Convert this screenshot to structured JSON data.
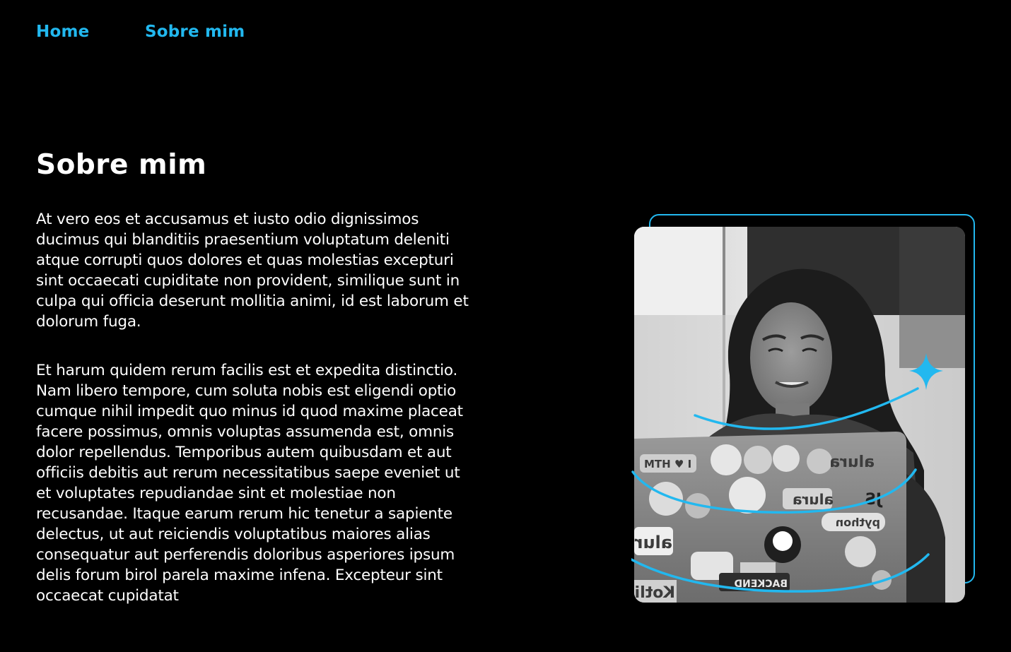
{
  "nav": {
    "items": [
      {
        "label": "Home"
      },
      {
        "label": "Sobre mim"
      }
    ]
  },
  "about": {
    "title": "Sobre mim",
    "paragraphs": [
      "At vero eos et accusamus et iusto odio dignissimos ducimus qui blanditiis praesentium voluptatum deleniti atque corrupti quos dolores et quas molestias excepturi sint occaecati cupiditate non provident, similique sunt in culpa qui officia deserunt mollitia animi, id est laborum et dolorum fuga.",
      "Et harum quidem rerum facilis est et expedita distinctio. Nam libero tempore, cum soluta nobis est eligendi optio cumque nihil impedit quo minus id quod maxime placeat facere possimus, omnis voluptas assumenda est, omnis dolor repellendus. Temporibus autem quibusdam et aut officiis debitis aut rerum necessitatibus saepe eveniet ut et voluptates repudiandae sint et molestiae non recusandae. Itaque earum rerum hic tenetur a sapiente delectus, ut aut reiciendis voluptatibus maiores alias consequatur aut perferendis doloribus asperiores ipsum delis forum birol parela maxime infena. Excepteur sint occaecat cupidatat"
    ]
  },
  "photo": {
    "laptop_stickers": [
      "MTH ♥ I",
      "alura",
      "alura",
      "JS",
      "python",
      "alura",
      "BACKEND",
      "Kotlin"
    ]
  },
  "colors": {
    "background": "#000000",
    "accent": "#22b8ef",
    "text": "#ffffff"
  },
  "icons": {
    "sparkle": "sparkle-icon"
  }
}
